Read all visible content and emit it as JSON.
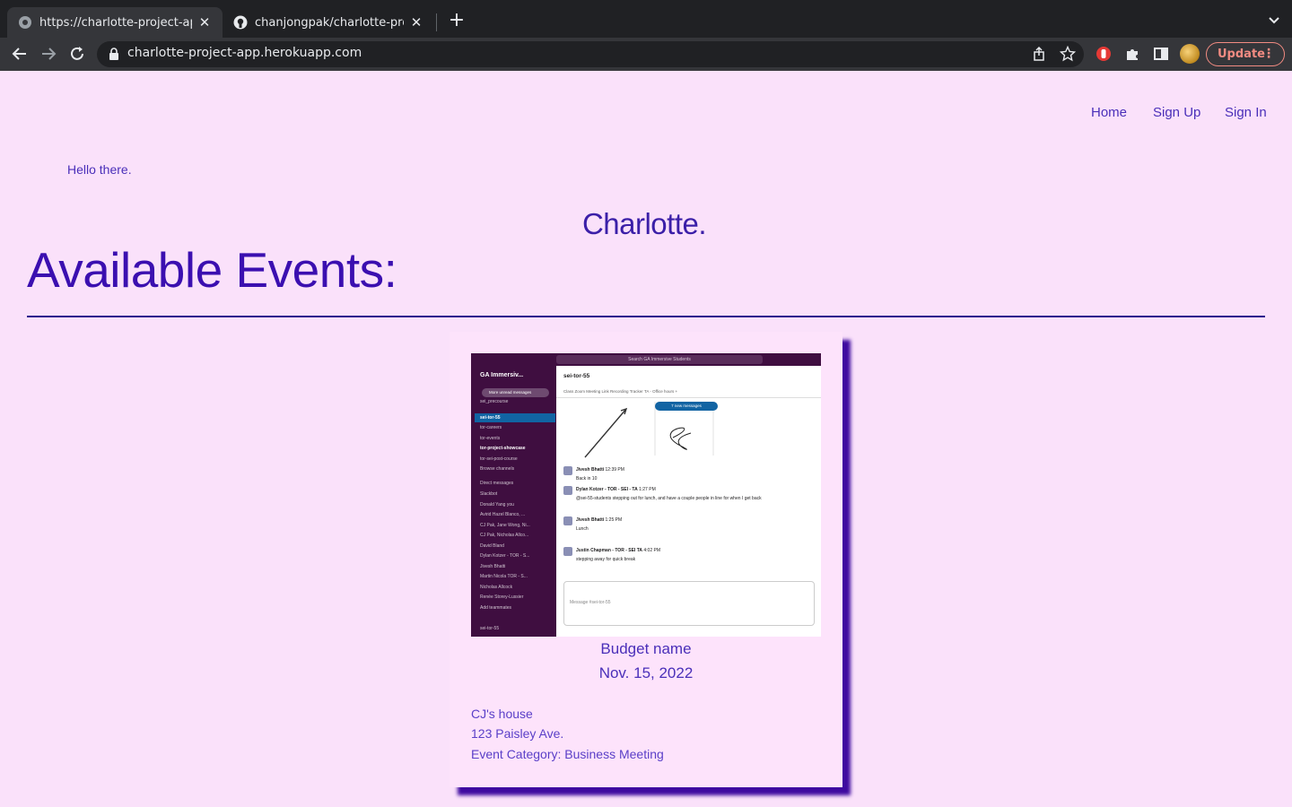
{
  "browser": {
    "tabs": [
      {
        "title": "https://charlotte-project-app.h",
        "active": true
      },
      {
        "title": "chanjongpak/charlotte-project",
        "active": false
      }
    ],
    "new_tab": "+",
    "url": "charlotte-project-app.herokuapp.com",
    "update_label": "Update"
  },
  "nav": {
    "home": "Home",
    "sign_up": "Sign Up",
    "sign_in": "Sign In"
  },
  "greeting": "Hello there.",
  "brand": "Charlotte.",
  "section_title": "Available Events:",
  "events": [
    {
      "name": "Budget name",
      "date": "Nov. 15, 2022",
      "venue": "CJ's house",
      "address": "123 Paisley Ave.",
      "category": "Event Category: Business Meeting",
      "image": {
        "search": "Search GA Immersive Students",
        "workspace": "GA Immersiv...",
        "unread_pill": "More unread messages",
        "channels": [
          "sei_precourse",
          "sei-tor-55",
          "tor-careers",
          "tor-events",
          "tor-project-showcase",
          "tor-sei-post-course",
          "Browse channels"
        ],
        "dm_header": "Direct messages",
        "dms": [
          "Slackbot",
          "Donald Yang  you",
          "Avirid Hazel Blanco, ...",
          "CJ Pak, Jane Wong, Ni...",
          "CJ Pak, Nicholas Allco...",
          "David Bland",
          "Dylan Kotzer - TOR - S...",
          "Jivesh Bhatti",
          "Martin Nicola TOR - S...",
          "Nicholas Allcock",
          "Renée Storey-Lussier",
          "Add teammates"
        ],
        "footer_channel": "sei-tor-55",
        "channel": "sei-tor-55",
        "bookmarks": "Class Zoom Meeting Link   Recording Tracker   TA - Office hours   +",
        "new_messages": "7 new messages",
        "messages": [
          {
            "author": "Jivesh Bhatti",
            "time": "12:39 PM",
            "text": "Back in 10"
          },
          {
            "author": "Dylan Kotzer - TOR - SEI - TA",
            "time": "1:27 PM",
            "text": "@sei-55-students stepping out for lunch, and have a couple people in line for when I get back"
          },
          {
            "author": "Jivesh Bhatti",
            "time": "1:25 PM",
            "text": "Lunch"
          },
          {
            "author": "Justin Chapman - TOR - SEI TA",
            "time": "4:02 PM",
            "text": "stepping away for quick break"
          }
        ],
        "composer": "Message #sei-tor-55"
      }
    }
  ],
  "colors": {
    "page_bg": "#fae1fa",
    "accent": "#3b0fb0",
    "card_shadow": "#3e0aa0",
    "update": "#f28b82"
  }
}
